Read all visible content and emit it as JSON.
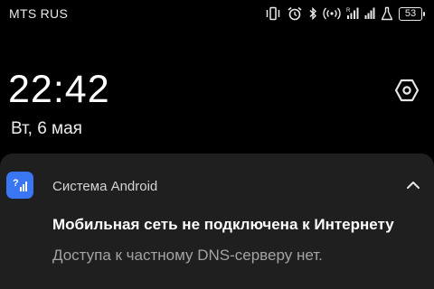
{
  "status_bar": {
    "carrier": "MTS RUS",
    "battery_level": "53",
    "icons": [
      "vibrate-icon",
      "alarm-icon",
      "bluetooth-icon",
      "hotspot-icon",
      "signal-icon",
      "signal-icon",
      "lab-icon"
    ]
  },
  "lockscreen": {
    "time": "22:42",
    "date": "Вт, 6 мая",
    "settings_icon": "settings-hexagon-icon"
  },
  "notification": {
    "app_name": "Система Android",
    "app_icon": "android-signal-icon",
    "title": "Мобильная сеть не подключена к Интернету",
    "text": "Доступа к частному DNS-серверу нет.",
    "collapse_icon": "chevron-up-icon",
    "colors": {
      "background": "#1f1f1f",
      "app_icon_bg": "#3a76f2",
      "secondary_text": "#a3a3a3"
    }
  }
}
